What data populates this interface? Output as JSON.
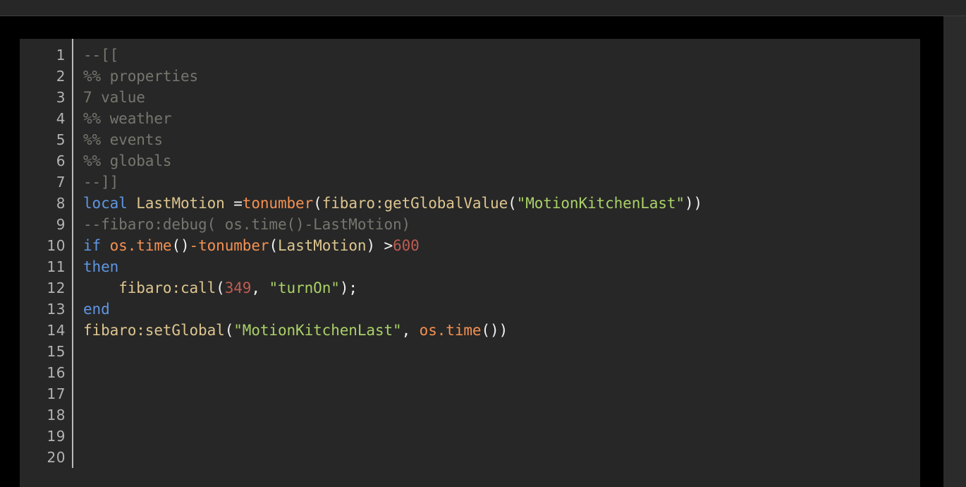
{
  "window": {
    "background_color": "#2b2b2b",
    "void_color": "#000000",
    "editor_background_color": "#272727"
  },
  "editor": {
    "language": "Lua",
    "gutter": {
      "divider_color": "#b9b9b9",
      "line_number_color": "#b3b3b3",
      "line_numbers": [
        "1",
        "2",
        "3",
        "4",
        "5",
        "6",
        "7",
        "8",
        "9",
        "10",
        "11",
        "12",
        "13",
        "14",
        "15",
        "16",
        "17",
        "18",
        "19",
        "20"
      ]
    },
    "theme": {
      "comment": "#76766f",
      "keyword": "#5f96e3",
      "builtin": "#f49152",
      "identifier": "#ddc58f",
      "string": "#aad168",
      "number": "#bf5b52",
      "punctuation": "#f2f2f2"
    },
    "lines": [
      {
        "number": "1",
        "plain": "--[[",
        "tokens": [
          {
            "t": "--[[",
            "c": "comment"
          }
        ]
      },
      {
        "number": "2",
        "plain": "%% properties",
        "tokens": [
          {
            "t": "%% properties",
            "c": "comment"
          }
        ]
      },
      {
        "number": "3",
        "plain": "7 value",
        "tokens": [
          {
            "t": "7 value",
            "c": "comment"
          }
        ]
      },
      {
        "number": "4",
        "plain": "%% weather",
        "tokens": [
          {
            "t": "%% weather",
            "c": "comment"
          }
        ]
      },
      {
        "number": "5",
        "plain": "%% events",
        "tokens": [
          {
            "t": "%% events",
            "c": "comment"
          }
        ]
      },
      {
        "number": "6",
        "plain": "%% globals",
        "tokens": [
          {
            "t": "%% globals",
            "c": "comment"
          }
        ]
      },
      {
        "number": "7",
        "plain": "--]]",
        "tokens": [
          {
            "t": "--]]",
            "c": "comment"
          }
        ]
      },
      {
        "number": "8",
        "plain": "local LastMotion =tonumber(fibaro:getGlobalValue(\"MotionKitchenLast\"))",
        "tokens": [
          {
            "t": "local",
            "c": "keyword"
          },
          {
            "t": " ",
            "c": "punct"
          },
          {
            "t": "LastMotion",
            "c": "ident"
          },
          {
            "t": " =",
            "c": "op"
          },
          {
            "t": "tonumber",
            "c": "builtin"
          },
          {
            "t": "(",
            "c": "punct"
          },
          {
            "t": "fibaro:getGlobalValue",
            "c": "ident"
          },
          {
            "t": "(",
            "c": "punct"
          },
          {
            "t": "\"MotionKitchenLast\"",
            "c": "string"
          },
          {
            "t": "))",
            "c": "punct"
          }
        ]
      },
      {
        "number": "9",
        "plain": "--fibaro:debug( os.time()-LastMotion)",
        "tokens": [
          {
            "t": "--fibaro:debug( os.time()-LastMotion)",
            "c": "comment"
          }
        ]
      },
      {
        "number": "10",
        "plain": "if os.time()-tonumber(LastMotion) >600",
        "tokens": [
          {
            "t": "if",
            "c": "keyword"
          },
          {
            "t": " ",
            "c": "punct"
          },
          {
            "t": "os.time",
            "c": "builtin"
          },
          {
            "t": "()",
            "c": "punct"
          },
          {
            "t": "-",
            "c": "builtin"
          },
          {
            "t": "tonumber",
            "c": "builtin"
          },
          {
            "t": "(",
            "c": "punct"
          },
          {
            "t": "LastMotion",
            "c": "ident"
          },
          {
            "t": ") >",
            "c": "punct"
          },
          {
            "t": "600",
            "c": "number"
          }
        ]
      },
      {
        "number": "11",
        "plain": "then",
        "tokens": [
          {
            "t": "then",
            "c": "keyword"
          }
        ]
      },
      {
        "number": "12",
        "plain": "    fibaro:call(349, \"turnOn\");",
        "tokens": [
          {
            "t": "    ",
            "c": "punct"
          },
          {
            "t": "fibaro:call",
            "c": "ident"
          },
          {
            "t": "(",
            "c": "punct"
          },
          {
            "t": "349",
            "c": "number"
          },
          {
            "t": ", ",
            "c": "punct"
          },
          {
            "t": "\"turnOn\"",
            "c": "string"
          },
          {
            "t": ");",
            "c": "punct"
          }
        ]
      },
      {
        "number": "13",
        "plain": "end",
        "tokens": [
          {
            "t": "end",
            "c": "keyword"
          }
        ]
      },
      {
        "number": "14",
        "plain": "fibaro:setGlobal(\"MotionKitchenLast\", os.time())",
        "tokens": [
          {
            "t": "fibaro:setGlobal",
            "c": "ident"
          },
          {
            "t": "(",
            "c": "punct"
          },
          {
            "t": "\"MotionKitchenLast\"",
            "c": "string"
          },
          {
            "t": ", ",
            "c": "punct"
          },
          {
            "t": "os.time",
            "c": "builtin"
          },
          {
            "t": "())",
            "c": "punct"
          }
        ]
      },
      {
        "number": "15",
        "plain": "",
        "tokens": []
      },
      {
        "number": "16",
        "plain": "",
        "tokens": []
      },
      {
        "number": "17",
        "plain": "",
        "tokens": []
      },
      {
        "number": "18",
        "plain": "",
        "tokens": []
      },
      {
        "number": "19",
        "plain": "",
        "tokens": []
      },
      {
        "number": "20",
        "plain": "",
        "tokens": []
      }
    ]
  }
}
